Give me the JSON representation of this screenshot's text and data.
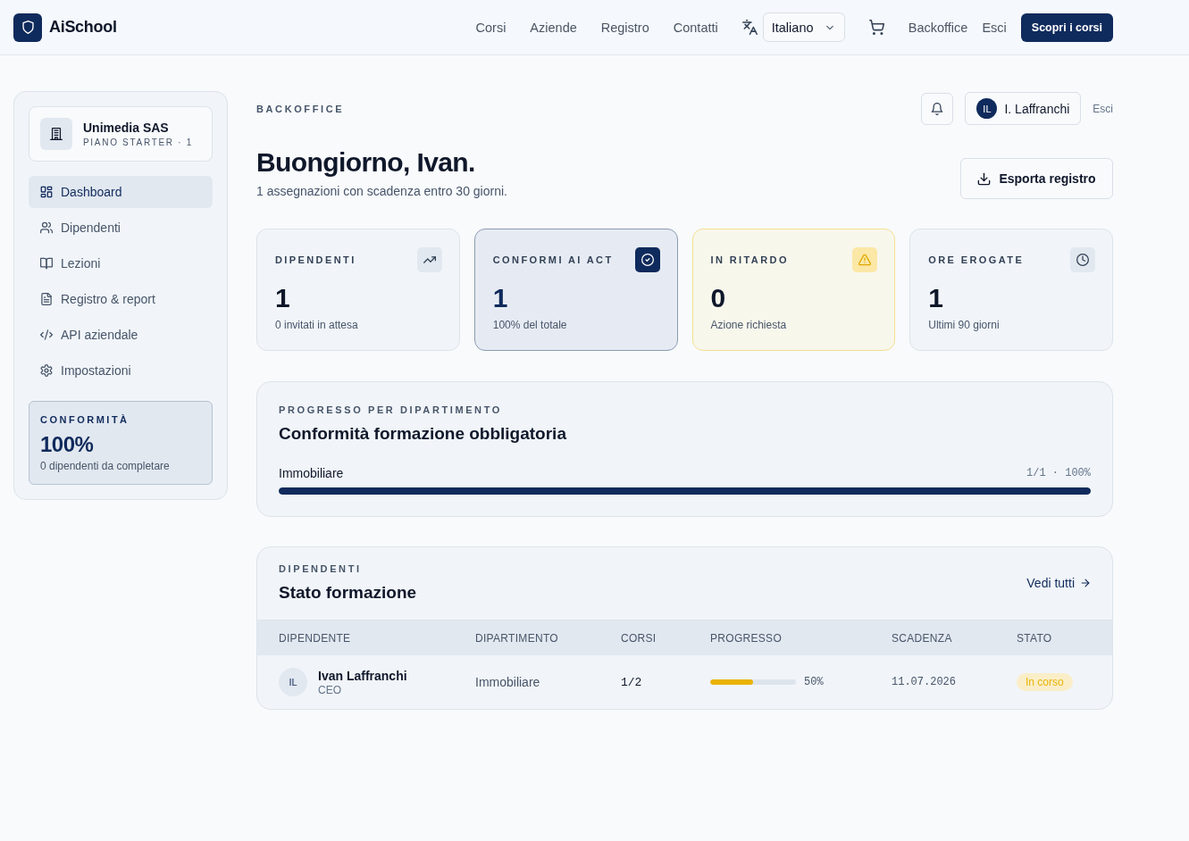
{
  "topbar": {
    "brand": "AiSchool",
    "nav": [
      "Corsi",
      "Aziende",
      "Registro",
      "Contatti"
    ],
    "language": "Italiano",
    "links": [
      "Backoffice",
      "Esci"
    ],
    "cta": "Scopri i corsi"
  },
  "sidebar": {
    "org": {
      "name": "Unimedia SAS",
      "plan": "PIANO STARTER · 1"
    },
    "items": [
      {
        "label": "Dashboard",
        "selected": true
      },
      {
        "label": "Dipendenti",
        "selected": false
      },
      {
        "label": "Lezioni",
        "selected": false
      },
      {
        "label": "Registro & report",
        "selected": false
      },
      {
        "label": "API aziendale",
        "selected": false
      },
      {
        "label": "Impostazioni",
        "selected": false
      }
    ],
    "compliance": {
      "label": "CONFORMITÀ",
      "value": "100%",
      "note": "0 dipendenti da completare"
    }
  },
  "header": {
    "eyebrow": "BACKOFFICE",
    "user": {
      "initials": "IL",
      "name": "I. Laffranchi"
    },
    "logout": "Esci",
    "greeting": "Buongiorno, Ivan.",
    "subtitle": "1 assegnazioni con scadenza entro 30 giorni.",
    "export": "Esporta registro"
  },
  "stats": [
    {
      "kind": "plain",
      "label": "DIPENDENTI",
      "value": "1",
      "note": "0 invitati in attesa"
    },
    {
      "kind": "accent",
      "label": "CONFORMI AI ACT",
      "value": "1",
      "note": "100% del totale"
    },
    {
      "kind": "warning",
      "label": "IN RITARDO",
      "value": "0",
      "note": "Azione richiesta"
    },
    {
      "kind": "plain",
      "label": "ORE EROGATE",
      "value": "1",
      "note": "Ultimi 90 giorni"
    }
  ],
  "progress": {
    "eyebrow": "PROGRESSO PER DIPARTIMENTO",
    "title": "Conformità formazione obbligatoria",
    "departments": [
      {
        "name": "Immobiliare",
        "reading": "1/1 · 100%",
        "level": 1
      }
    ]
  },
  "employees": {
    "eyebrow": "DIPENDENTI",
    "title": "Stato formazione",
    "link": "Vedi tutti",
    "columns": [
      "DIPENDENTE",
      "DIPARTIMENTO",
      "CORSI",
      "PROGRESSO",
      "SCADENZA",
      "STATO"
    ],
    "rows": [
      {
        "initials": "IL",
        "name": "Ivan Laffranchi",
        "role": "CEO",
        "department": "Immobiliare",
        "courses": "1/2",
        "level": 0.5,
        "percent": "50%",
        "due": "11.07.2026",
        "status": {
          "label": "In corso",
          "color": "#eab308"
        }
      }
    ]
  }
}
